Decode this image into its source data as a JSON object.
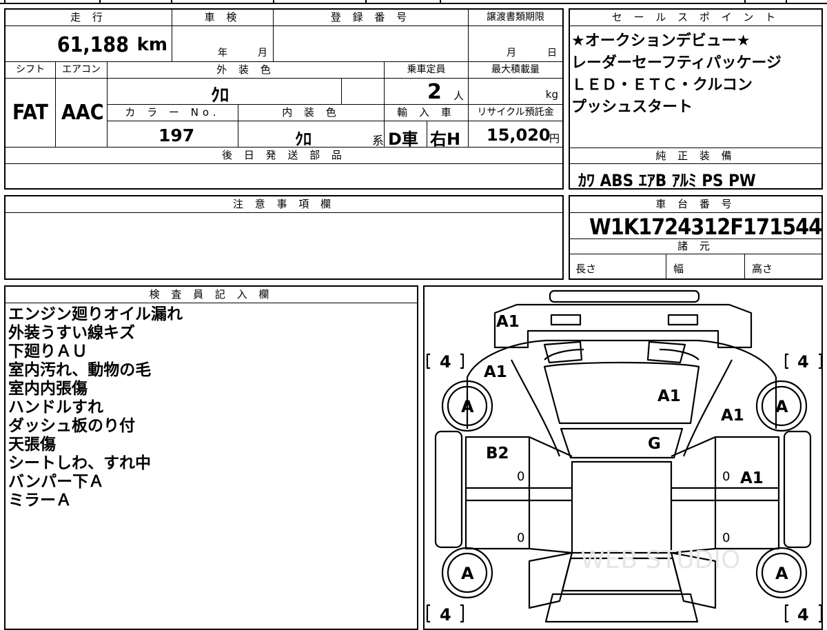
{
  "top_strip": {
    "fragment": "…"
  },
  "vehicle": {
    "mileage": {
      "label": "走 行",
      "value": "61,188",
      "unit": "km"
    },
    "inspection": {
      "label": "車 検",
      "year_label": "年",
      "month_label": "月"
    },
    "registration": {
      "label": "登 録 番 号",
      "value": ""
    },
    "transfer_deadline": {
      "label": "譲渡書類期限",
      "month_label": "月",
      "day_label": "日"
    },
    "shift": {
      "label": "シフト",
      "value": "FAT"
    },
    "aircon": {
      "label": "エアコン",
      "value": "AAC"
    },
    "exterior_color": {
      "label": "外 装 色",
      "value": "ｸﾛ"
    },
    "capacity": {
      "label": "乗車定員",
      "value": "2",
      "unit": "人"
    },
    "max_load": {
      "label": "最大積載量",
      "unit": "kg"
    },
    "color_no": {
      "label": "カ ラ ー No.",
      "value": "197"
    },
    "interior_color": {
      "label": "内 装 色",
      "value": "ｸﾛ",
      "suffix": "系"
    },
    "import": {
      "label": "輸 入 車",
      "dealer": "D車",
      "steering": "右H"
    },
    "recycle": {
      "label": "リサイクル預託金",
      "value": "15,020",
      "unit": "円"
    },
    "later_parts": {
      "label": "後 日 発 送 部 品",
      "value": ""
    }
  },
  "sales_points": {
    "label": "セ ー ル ス ポ イ ン ト",
    "lines": [
      "★オークションデビュー★",
      "レーダーセーフティパッケージ",
      "ＬＥＤ・ＥＴＣ・クルコン",
      "プッシュスタート"
    ]
  },
  "genuine_equipment": {
    "label": "純 正 装 備",
    "value": "ｶﾜ ABS ｴｱB ｱﾙﾐ PS PW"
  },
  "notes": {
    "label": "注 意 事 項 欄",
    "value": ""
  },
  "chassis": {
    "label": "車 台 番 号",
    "value": "W1K1724312F171544"
  },
  "specs": {
    "label": "諸 元",
    "length": "長さ",
    "width": "幅",
    "height": "高さ"
  },
  "inspector": {
    "label": "検 査 員 記 入 欄",
    "lines": [
      "エンジン廻りオイル漏れ",
      "外装うすい線キズ",
      "下廻りＡＵ",
      "室内汚れ、動物の毛",
      "室内内張傷",
      "ハンドルすれ",
      "ダッシュ板のり付",
      "天張傷",
      "シートしわ、すれ中",
      "バンパー下Ａ",
      "ミラーＡ"
    ]
  },
  "diagram": {
    "tire_depth": "4",
    "wheel_grade": "A",
    "marks": {
      "front_bumper": "A1",
      "front_left": "A1",
      "hood": "A1",
      "front_right": "A1",
      "windshield": "G",
      "left_front_door": "B2",
      "right_front_door": "A1",
      "door_zero": "0"
    },
    "watermark": "WEB STUDIO"
  }
}
